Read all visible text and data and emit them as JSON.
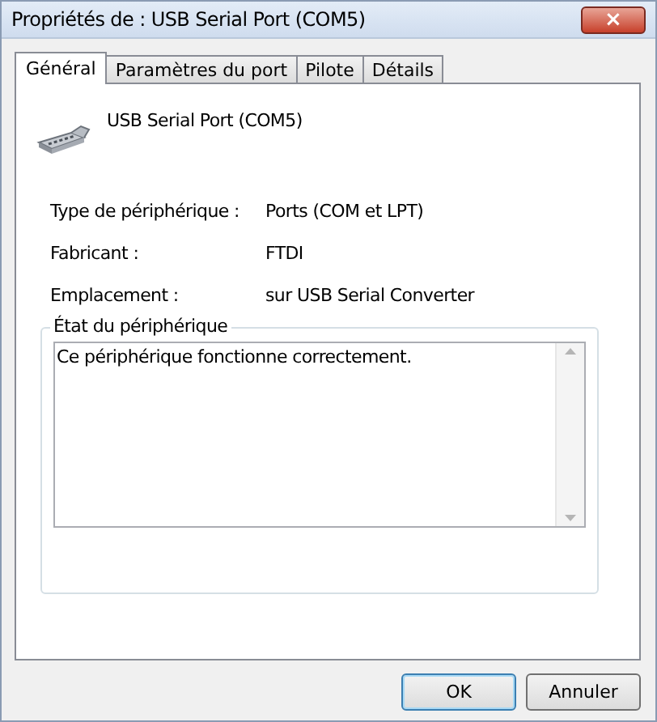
{
  "window": {
    "title": "Propriétés de : USB Serial Port (COM5)",
    "close": "×"
  },
  "tabs": [
    {
      "label": "Général",
      "selected": true
    },
    {
      "label": "Paramètres du port",
      "selected": false
    },
    {
      "label": "Pilote",
      "selected": false
    },
    {
      "label": "Détails",
      "selected": false
    }
  ],
  "device": {
    "name": "USB Serial Port (COM5)"
  },
  "properties": [
    {
      "label": "Type de périphérique :",
      "value": "Ports (COM et LPT)"
    },
    {
      "label": "Fabricant :",
      "value": "FTDI"
    },
    {
      "label": "Emplacement :",
      "value": "sur USB Serial Converter"
    }
  ],
  "status_group": {
    "title": "État du périphérique",
    "text": "Ce périphérique fonctionne correctement."
  },
  "buttons": [
    {
      "label": "OK",
      "default": true
    },
    {
      "label": "Annuler",
      "default": false
    }
  ]
}
